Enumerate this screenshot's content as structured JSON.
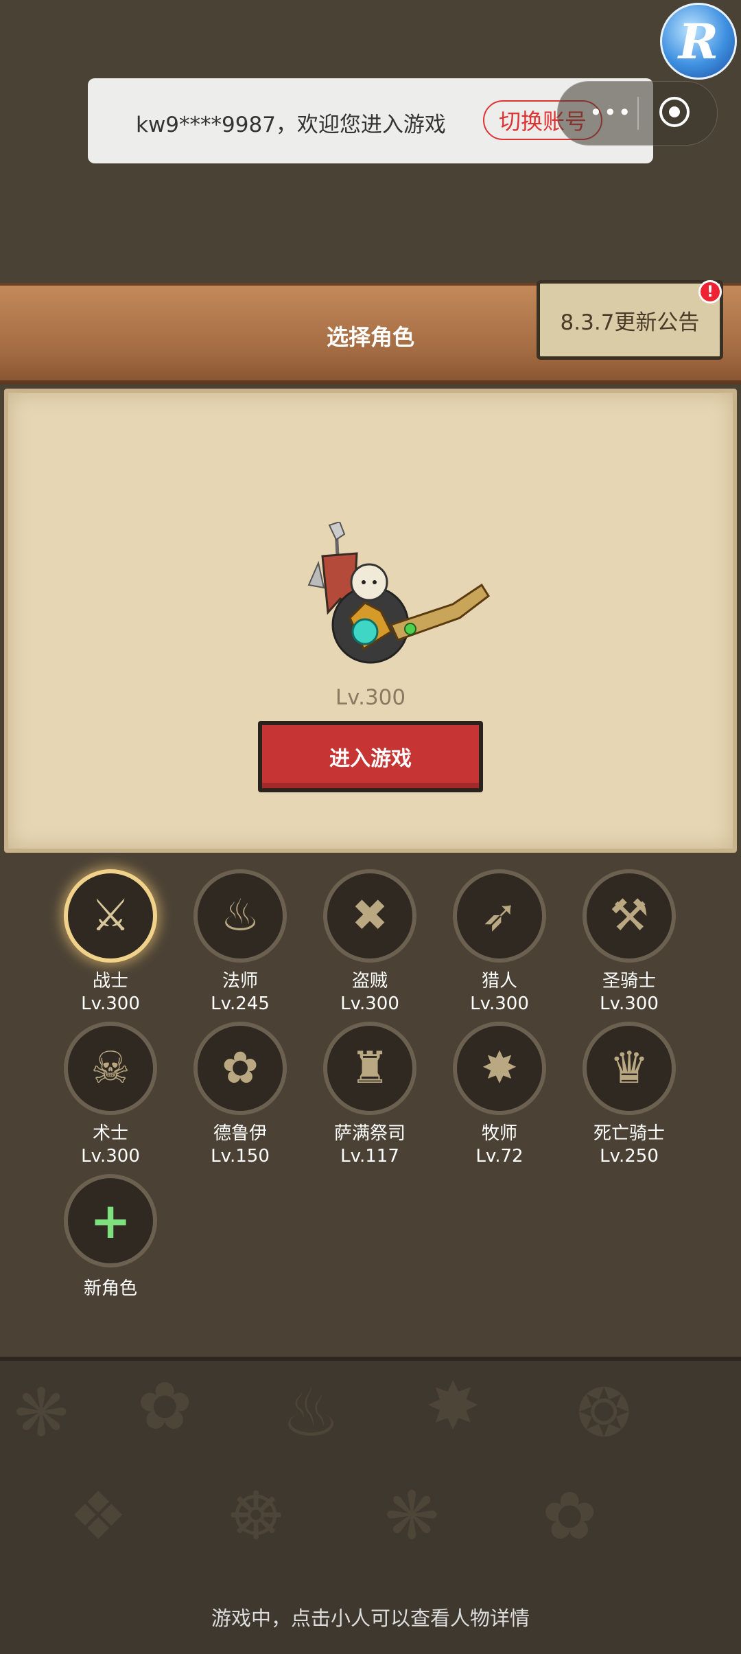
{
  "header": {
    "welcome": "kw9****9987，欢迎您进入游戏",
    "switch_account": "切换账号",
    "capsule_dots": "•••",
    "logo_letter": "R"
  },
  "title_bar": {
    "title": "选择角色",
    "notice_button": "8.3.7更新公告",
    "notice_badge": "!"
  },
  "preview": {
    "level": "Lv.300",
    "enter_button": "进入游戏"
  },
  "classes": [
    {
      "name": "战士",
      "level": "Lv.300",
      "icon": "sword-shield-icon",
      "glyph": "⚔",
      "selected": true
    },
    {
      "name": "法师",
      "level": "Lv.245",
      "icon": "flame-icon",
      "glyph": "♨",
      "selected": false
    },
    {
      "name": "盗贼",
      "level": "Lv.300",
      "icon": "daggers-icon",
      "glyph": "✖",
      "selected": false
    },
    {
      "name": "猎人",
      "level": "Lv.300",
      "icon": "arrows-icon",
      "glyph": "➶",
      "selected": false
    },
    {
      "name": "圣骑士",
      "level": "Lv.300",
      "icon": "hammer-icon",
      "glyph": "⚒",
      "selected": false
    },
    {
      "name": "术士",
      "level": "Lv.300",
      "icon": "skull-horns-icon",
      "glyph": "☠",
      "selected": false
    },
    {
      "name": "德鲁伊",
      "level": "Lv.150",
      "icon": "paw-icon",
      "glyph": "✿",
      "selected": false
    },
    {
      "name": "萨满祭司",
      "level": "Lv.117",
      "icon": "totem-icon",
      "glyph": "♜",
      "selected": false
    },
    {
      "name": "牧师",
      "level": "Lv.72",
      "icon": "holy-star-icon",
      "glyph": "✸",
      "selected": false
    },
    {
      "name": "死亡骑士",
      "level": "Lv.250",
      "icon": "helm-icon",
      "glyph": "♛",
      "selected": false
    }
  ],
  "new_character": {
    "label": "新角色",
    "glyph": "+"
  },
  "footer": {
    "tip": "游戏中，点击小人可以查看人物详情"
  }
}
